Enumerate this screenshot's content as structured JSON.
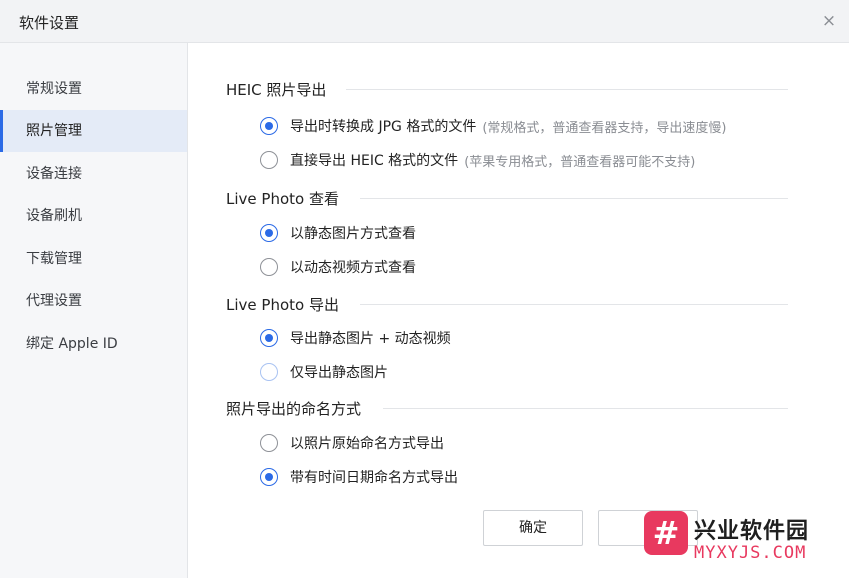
{
  "window": {
    "title": "软件设置",
    "close_icon": "×"
  },
  "sidebar": {
    "items": [
      {
        "label": "常规设置",
        "active": false
      },
      {
        "label": "照片管理",
        "active": true
      },
      {
        "label": "设备连接",
        "active": false
      },
      {
        "label": "设备刷机",
        "active": false
      },
      {
        "label": "下载管理",
        "active": false
      },
      {
        "label": "代理设置",
        "active": false
      },
      {
        "label": "绑定 Apple ID",
        "active": false
      }
    ]
  },
  "sections": [
    {
      "title": "HEIC 照片导出",
      "options": [
        {
          "label": "导出时转换成 JPG 格式的文件",
          "hint": "(常规格式，普通查看器支持，导出速度慢)",
          "checked": true
        },
        {
          "label": "直接导出 HEIC 格式的文件",
          "hint": "(苹果专用格式，普通查看器可能不支持)",
          "checked": false
        }
      ]
    },
    {
      "title": "Live Photo 查看",
      "options": [
        {
          "label": "以静态图片方式查看",
          "hint": "",
          "checked": true
        },
        {
          "label": "以动态视频方式查看",
          "hint": "",
          "checked": false
        }
      ]
    },
    {
      "title": "Live Photo 导出",
      "options": [
        {
          "label": "导出静态图片 + 动态视频",
          "hint": "",
          "checked": true
        },
        {
          "label": "仅导出静态图片",
          "hint": "",
          "checked": false
        }
      ]
    },
    {
      "title": "照片导出的命名方式",
      "options": [
        {
          "label": "以照片原始命名方式导出",
          "hint": "",
          "checked": false
        },
        {
          "label": "带有时间日期命名方式导出",
          "hint": "",
          "checked": true
        }
      ]
    }
  ],
  "buttons": {
    "confirm": "确定",
    "cancel": ""
  },
  "watermark": {
    "icon": "#",
    "name_cn": "兴业软件园",
    "name_en": "MYXYJS.COM"
  },
  "colors": {
    "accent": "#2b6ae6",
    "watermark": "#e8395f"
  }
}
